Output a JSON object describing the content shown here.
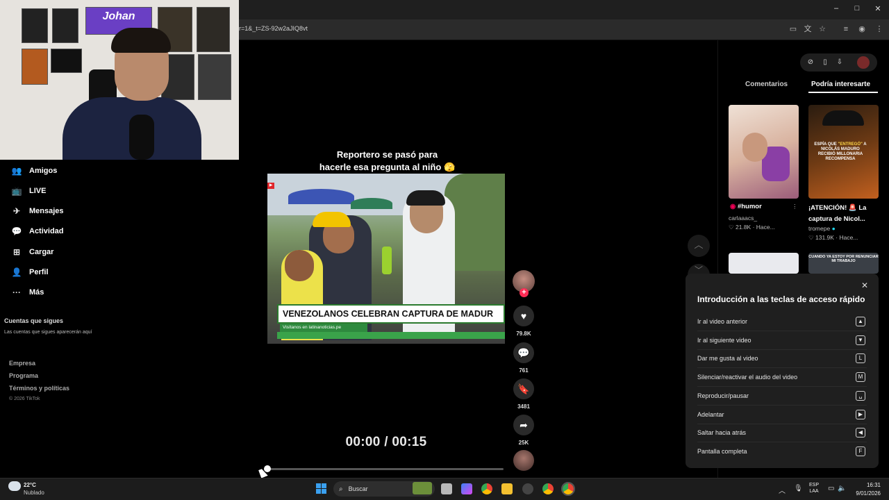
{
  "browser": {
    "url": "r=1&_t=ZS-92w2aJIQ8vt",
    "window_controls": {
      "minimize": "–",
      "maximize": "□",
      "close": "✕"
    }
  },
  "webcam": {
    "poster_name": "Johan"
  },
  "sidebar": {
    "items": [
      {
        "label": "Amigos",
        "icon": "friends-icon",
        "glyph": "👥"
      },
      {
        "label": "LIVE",
        "icon": "live-icon",
        "glyph": "📺"
      },
      {
        "label": "Mensajes",
        "icon": "messages-icon",
        "glyph": "✈"
      },
      {
        "label": "Actividad",
        "icon": "activity-icon",
        "glyph": "💬"
      },
      {
        "label": "Cargar",
        "icon": "upload-icon",
        "glyph": "⊞"
      },
      {
        "label": "Perfil",
        "icon": "profile-icon",
        "glyph": "👤"
      },
      {
        "label": "Más",
        "icon": "more-icon",
        "glyph": "···"
      }
    ],
    "following_title": "Cuentas que sigues",
    "following_desc": "Las cuentas que sigues aparecerán aquí",
    "footer_links": [
      "Empresa",
      "Programa",
      "Términos y políticas"
    ],
    "copyright": "© 2026 TikTok"
  },
  "video": {
    "caption_line1": "Reportero se pasó para",
    "caption_line2": "hacerle esa pregunta al niño 🫣",
    "chyron": "VENEZOLANOS CELEBRAN CAPTURA DE MADUR",
    "chyron_sub": "Visítanos en latinanoticias.pe",
    "time": "00:00 / 00:15",
    "progress": 0.0
  },
  "actions": {
    "likes": "79.8K",
    "comments": "761",
    "saves": "3481",
    "shares": "25K"
  },
  "right_panel": {
    "tabs": [
      "Comentarios",
      "Podría interesarte"
    ],
    "active_tab": 1,
    "cards": [
      {
        "title": "#humor",
        "author": "carlaaacs_",
        "meta": "21.8K · Hace..."
      },
      {
        "title": "¡ATENCIÓN! 🚨 La captura de Nicol...",
        "author": "tromepe",
        "meta": "131.9K · Hace..."
      }
    ],
    "card2_banner_pre": "ESPÍA QUE",
    "card2_banner_hl": "\"ENTREGÓ\"",
    "card2_banner_post": "A NICOLÁS MADURO RECIBIÓ MILLONARIA RECOMPENSA",
    "card4_banner": "CUANDO YA ESTOY POR RENUNCIAR MI TRABAJO"
  },
  "shortcuts": {
    "title": "Introducción a las teclas de acceso rápido",
    "items": [
      {
        "label": "Ir al video anterior",
        "key": "▲"
      },
      {
        "label": "Ir al siguiente video",
        "key": "▼"
      },
      {
        "label": "Dar me gusta al video",
        "key": "L"
      },
      {
        "label": "Silenciar/reactivar el audio del video",
        "key": "M"
      },
      {
        "label": "Reproducir/pausar",
        "key": "␣"
      },
      {
        "label": "Adelantar",
        "key": "▶"
      },
      {
        "label": "Saltar hacia atrás",
        "key": "◀"
      },
      {
        "label": "Pantalla completa",
        "key": "F"
      }
    ]
  },
  "taskbar": {
    "temp": "22°C",
    "weather": "Nublado",
    "search_placeholder": "Buscar",
    "lang_line1": "ESP",
    "lang_line2": "LAA",
    "time": "16:31",
    "date": "9/01/2026"
  },
  "colors": {
    "accent": "#fe2c55",
    "background": "#000000",
    "popup": "#1f1f1f"
  }
}
